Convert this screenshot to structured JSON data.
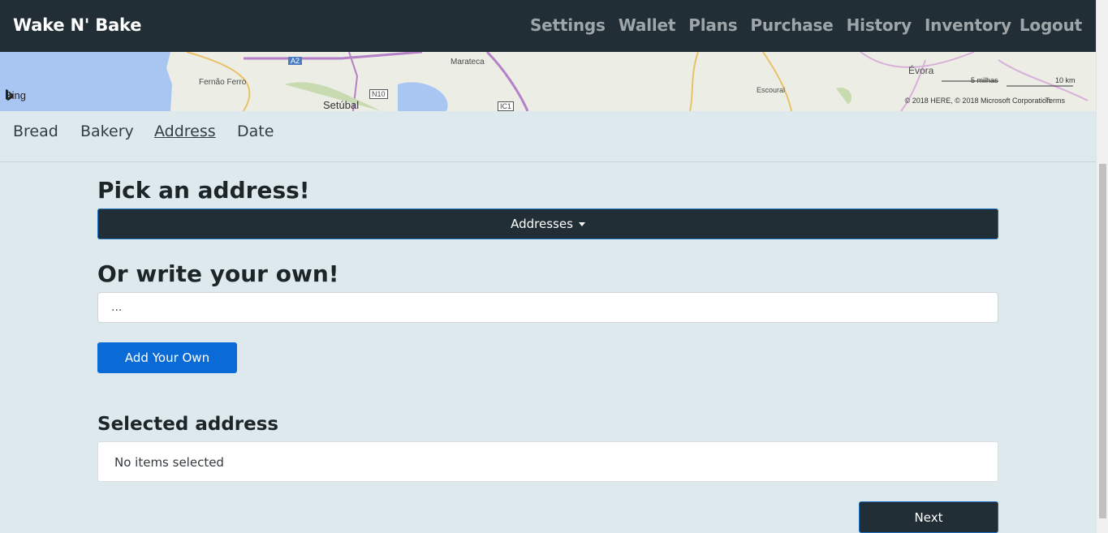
{
  "navbar": {
    "brand": "Wake N' Bake",
    "links": [
      "Settings",
      "Wallet",
      "Plans",
      "Purchase",
      "History",
      "Inventory",
      "Logout"
    ]
  },
  "map": {
    "provider": "Bing",
    "places": [
      "A2",
      "Marateca",
      "Fernão Ferro",
      "N10",
      "Setúbal",
      "IC1",
      "Escoural",
      "Évora"
    ],
    "scale_miles": "5 milhas",
    "scale_km": "10 km",
    "copyright": "© 2018 HERE, © 2018 Microsoft Corporation",
    "terms": "Terms"
  },
  "tabs": {
    "items": [
      "Bread",
      "Bakery",
      "Address",
      "Date"
    ],
    "active": "Address"
  },
  "address": {
    "pick_heading": "Pick an address!",
    "dropdown_label": "Addresses",
    "own_heading": "Or write your own!",
    "own_placeholder": "...",
    "add_button": "Add Your Own",
    "selected_heading": "Selected address",
    "selected_empty": "No items selected",
    "next_button": "Next"
  },
  "colors": {
    "navbar_bg": "#212e35",
    "page_bg": "#dde9ed",
    "primary": "#0a6ad6"
  }
}
